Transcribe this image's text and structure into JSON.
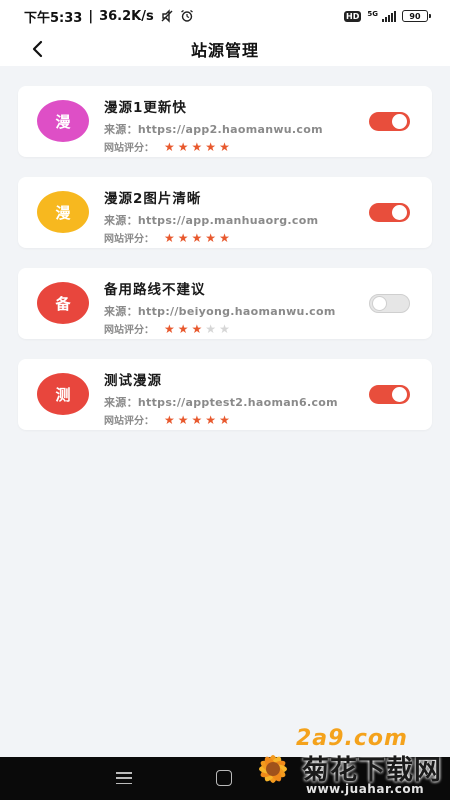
{
  "status_bar": {
    "time": "下午5:33",
    "net_speed": "36.2K/s",
    "hd": "HD",
    "network": "5G",
    "battery": "90"
  },
  "header": {
    "title": "站源管理"
  },
  "sources": [
    {
      "avatar_char": "漫",
      "avatar_color": "#de4fc6",
      "name": "漫源1更新快",
      "source": "来源：https://app2.haomanwu.com",
      "rating_label": "网站评分：",
      "rating": 5,
      "enabled": true
    },
    {
      "avatar_char": "漫",
      "avatar_color": "#f7b81f",
      "name": "漫源2图片清晰",
      "source": "来源：https://app.manhuaorg.com",
      "rating_label": "网站评分：",
      "rating": 5,
      "enabled": true
    },
    {
      "avatar_char": "备",
      "avatar_color": "#e8463d",
      "name": "备用路线不建议",
      "source": "来源：http://beiyong.haomanwu.com",
      "rating_label": "网站评分：",
      "rating": 3,
      "enabled": false
    },
    {
      "avatar_char": "测",
      "avatar_color": "#e8463d",
      "name": "测试漫源",
      "source": "来源：https://apptest2.haoman6.com",
      "rating_label": "网站评分：",
      "rating": 5,
      "enabled": true
    }
  ],
  "watermark": {
    "logo_text": "2a9.com",
    "site_name": "菊花下载网",
    "url": "www.juahar.com"
  },
  "colors": {
    "accent": "#e84e3c",
    "star": "#e8592e"
  }
}
